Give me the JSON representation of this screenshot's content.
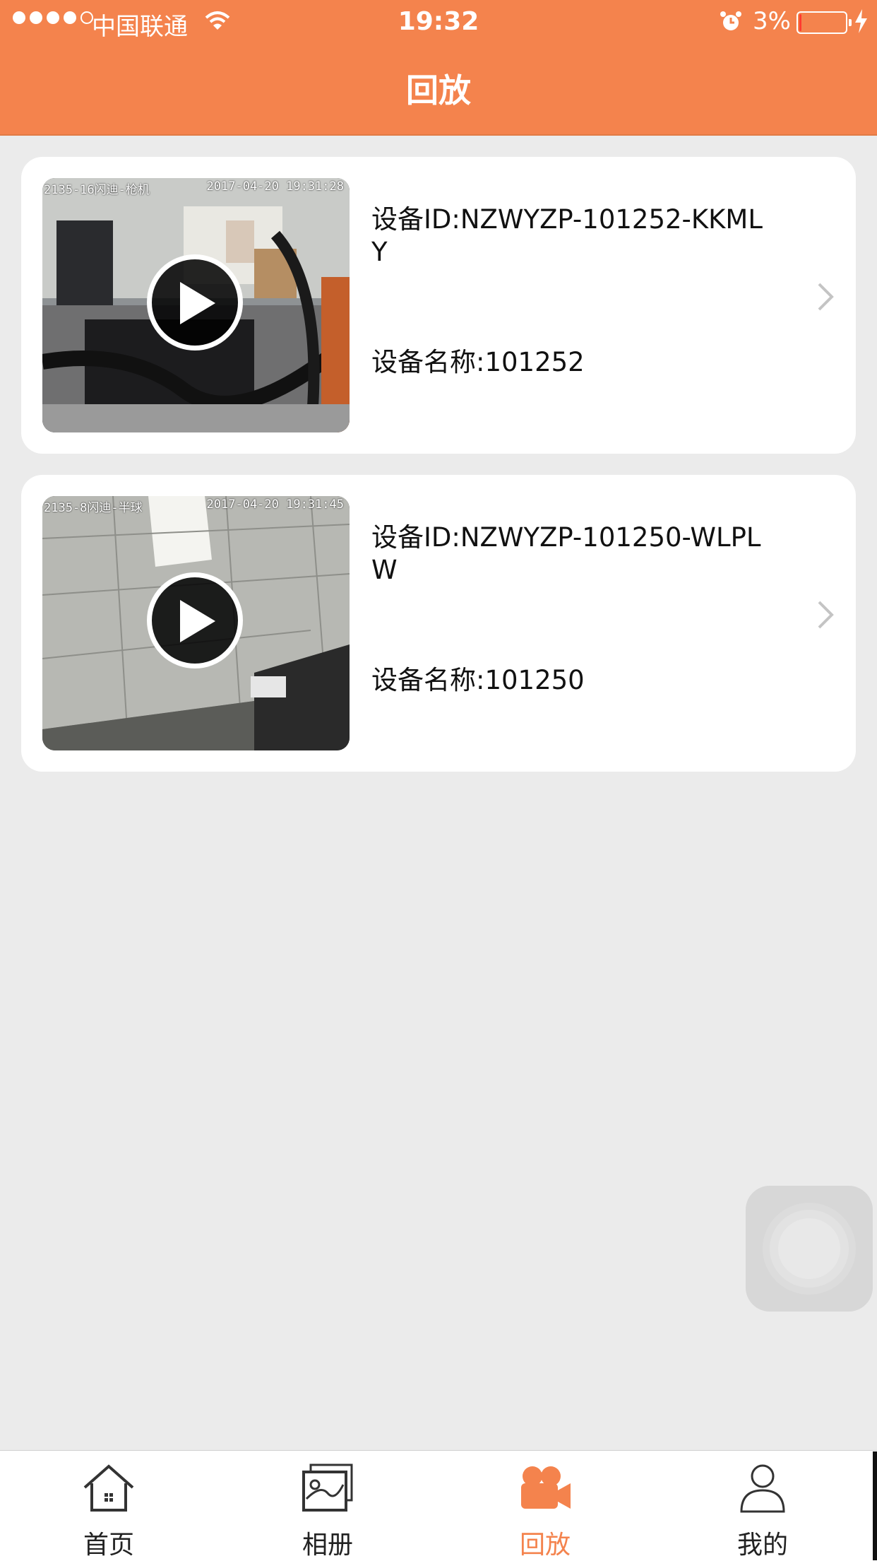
{
  "status_bar": {
    "carrier": "中国联通",
    "time": "19:32",
    "battery": "3%",
    "signal_bars": 4,
    "battery_level_percent": 3
  },
  "nav": {
    "title": "回放"
  },
  "devices": [
    {
      "osd_left": "2135-16闪迪-枪机",
      "osd_right": "2017-04-20 19:31:28",
      "id_text": "设备ID:NZWYZP-101252-KKMLY",
      "name_text": "设备名称:101252"
    },
    {
      "osd_left": "2135-8闪迪-半球",
      "osd_right": "2017-04-20 19:31:45",
      "id_text": "设备ID:NZWYZP-101250-WLPLW",
      "name_text": "设备名称:101250"
    }
  ],
  "tabs": [
    {
      "label": "首页",
      "icon": "home-icon",
      "active": false
    },
    {
      "label": "相册",
      "icon": "album-icon",
      "active": false
    },
    {
      "label": "回放",
      "icon": "video-camera-icon",
      "active": true
    },
    {
      "label": "我的",
      "icon": "user-icon",
      "active": false
    }
  ],
  "colors": {
    "accent": "#f4834d",
    "background": "#ebebeb"
  }
}
